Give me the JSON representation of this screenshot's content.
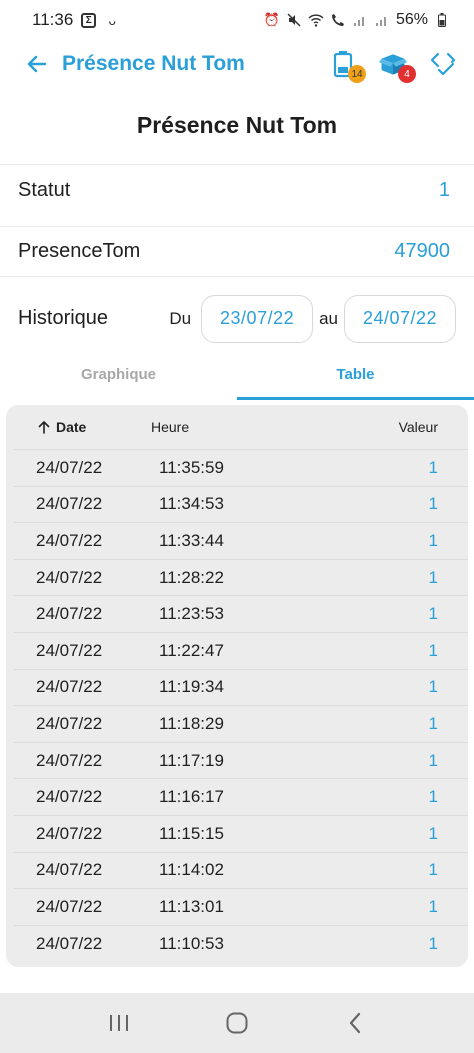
{
  "status_bar": {
    "time": "11:36",
    "battery": "56%"
  },
  "app_bar": {
    "title": "Présence Nut Tom",
    "battery_badge": "14",
    "box_badge": "4"
  },
  "page": {
    "title": "Présence Nut Tom"
  },
  "fields": {
    "statut_label": "Statut",
    "statut_value": "1",
    "presence_label": "PresenceTom",
    "presence_value": "47900"
  },
  "historique": {
    "label": "Historique",
    "from_label": "Du",
    "from_date": "23/07/22",
    "to_label": "au",
    "to_date": "24/07/22"
  },
  "tabs": [
    {
      "label": "Graphique",
      "active": false
    },
    {
      "label": "Table",
      "active": true
    }
  ],
  "table": {
    "headers": {
      "date": "Date",
      "heure": "Heure",
      "valeur": "Valeur"
    },
    "rows": [
      {
        "date": "24/07/22",
        "heure": "11:35:59",
        "valeur": "1"
      },
      {
        "date": "24/07/22",
        "heure": "11:34:53",
        "valeur": "1"
      },
      {
        "date": "24/07/22",
        "heure": "11:33:44",
        "valeur": "1"
      },
      {
        "date": "24/07/22",
        "heure": "11:28:22",
        "valeur": "1"
      },
      {
        "date": "24/07/22",
        "heure": "11:23:53",
        "valeur": "1"
      },
      {
        "date": "24/07/22",
        "heure": "11:22:47",
        "valeur": "1"
      },
      {
        "date": "24/07/22",
        "heure": "11:19:34",
        "valeur": "1"
      },
      {
        "date": "24/07/22",
        "heure": "11:18:29",
        "valeur": "1"
      },
      {
        "date": "24/07/22",
        "heure": "11:17:19",
        "valeur": "1"
      },
      {
        "date": "24/07/22",
        "heure": "11:16:17",
        "valeur": "1"
      },
      {
        "date": "24/07/22",
        "heure": "11:15:15",
        "valeur": "1"
      },
      {
        "date": "24/07/22",
        "heure": "11:14:02",
        "valeur": "1"
      },
      {
        "date": "24/07/22",
        "heure": "11:13:01",
        "valeur": "1"
      },
      {
        "date": "24/07/22",
        "heure": "11:10:53",
        "valeur": "1"
      }
    ]
  },
  "colors": {
    "accent": "#2a9fd8",
    "badge_orange": "#f0a018",
    "badge_red": "#e23030"
  },
  "icons": {
    "back": "arrow-left-icon",
    "battery": "battery-icon",
    "box": "box-icon",
    "check": "code-check-icon",
    "sort": "arrow-up-icon"
  }
}
